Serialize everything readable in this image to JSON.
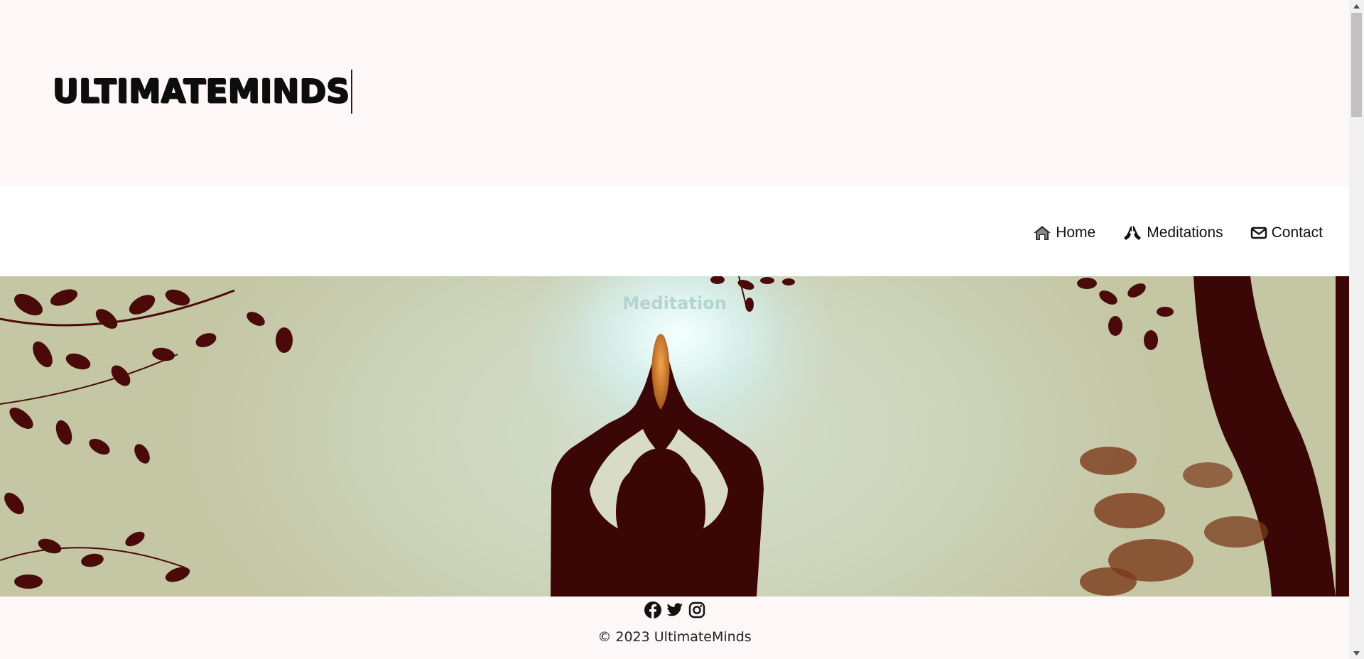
{
  "header": {
    "logo_text": "ULTIMATEMINDS"
  },
  "nav": {
    "items": [
      {
        "label": "Home",
        "icon": "home-icon"
      },
      {
        "label": "Meditations",
        "icon": "praying-hands-icon"
      },
      {
        "label": "Contact",
        "icon": "envelope-icon"
      }
    ]
  },
  "hero": {
    "title": "Meditation"
  },
  "footer": {
    "social": [
      "facebook-icon",
      "twitter-icon",
      "instagram-icon"
    ],
    "copyright": "© 2023 UltimateMinds"
  },
  "colors": {
    "header_bg": "#fdf8f7",
    "nav_bg": "#ffffff",
    "silhouette": "#3b0606",
    "hero_title": "#b5d3cf"
  }
}
